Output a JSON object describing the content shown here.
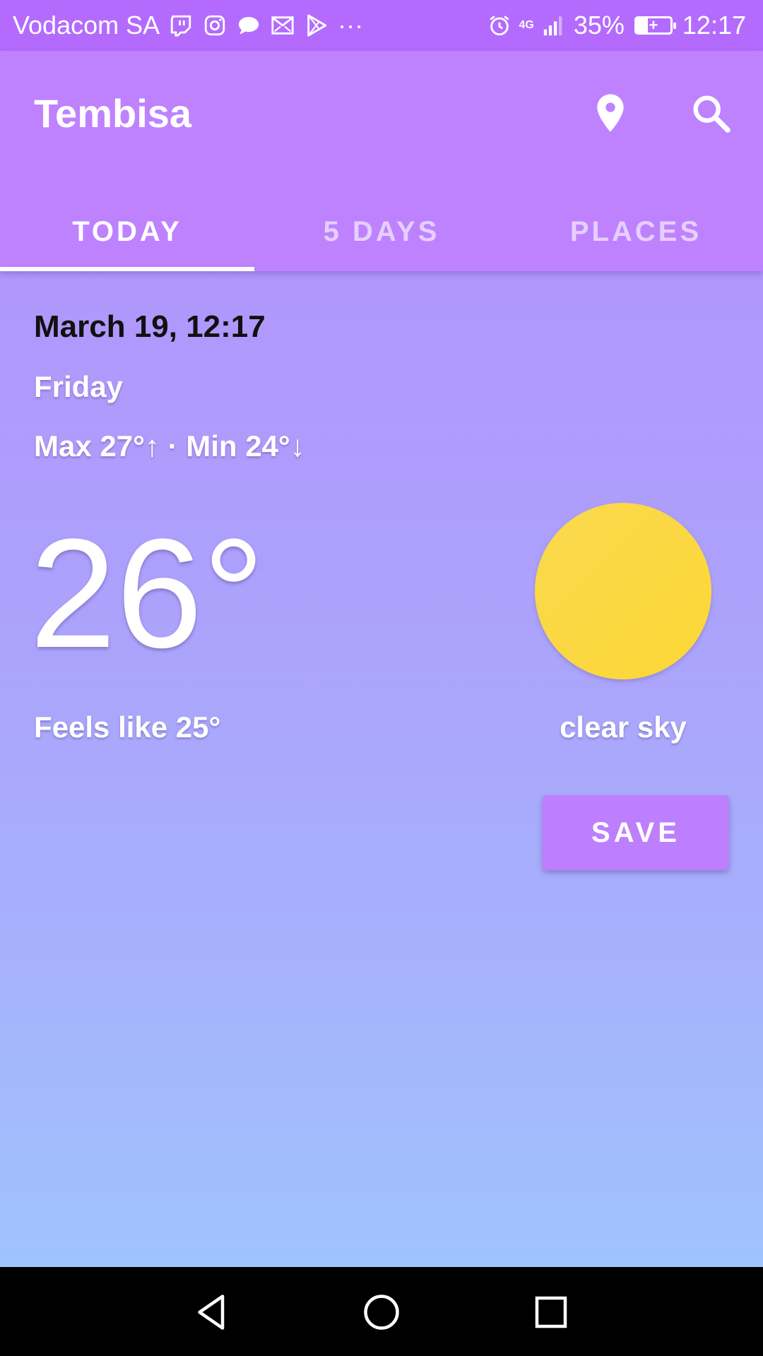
{
  "status_bar": {
    "carrier": "Vodacom SA",
    "more": "···",
    "network": "4G",
    "battery": "35%",
    "time": "12:17",
    "notification_icons": [
      "twitch-icon",
      "instagram-icon",
      "chat-bubble-icon",
      "gmail-icon",
      "play-store-icon"
    ],
    "system_icons": [
      "alarm-icon",
      "signal-icon",
      "battery-charging-icon"
    ]
  },
  "app_bar": {
    "title": "Tembisa",
    "actions": [
      "location-pin-icon",
      "search-icon"
    ],
    "colors": {
      "status_bar": "#b46bfd",
      "app_bar": "#be82ff"
    }
  },
  "tabs": [
    {
      "label": "TODAY",
      "active": true
    },
    {
      "label": "5 DAYS",
      "active": false
    },
    {
      "label": "PLACES",
      "active": false
    }
  ],
  "weather": {
    "datetime": "March 19, 12:17",
    "day": "Friday",
    "minmax": "Max 27°↑ · Min 24°↓",
    "temperature": "26°",
    "feels_like": "Feels like 25°",
    "condition": "clear sky",
    "condition_icon": "sun-icon",
    "sun_color": "#fbd83f"
  },
  "actions": {
    "save_label": "SAVE",
    "save_color": "#bd7ffd"
  },
  "nav_bar": {
    "buttons": [
      "back-icon",
      "home-icon",
      "recents-icon"
    ]
  }
}
